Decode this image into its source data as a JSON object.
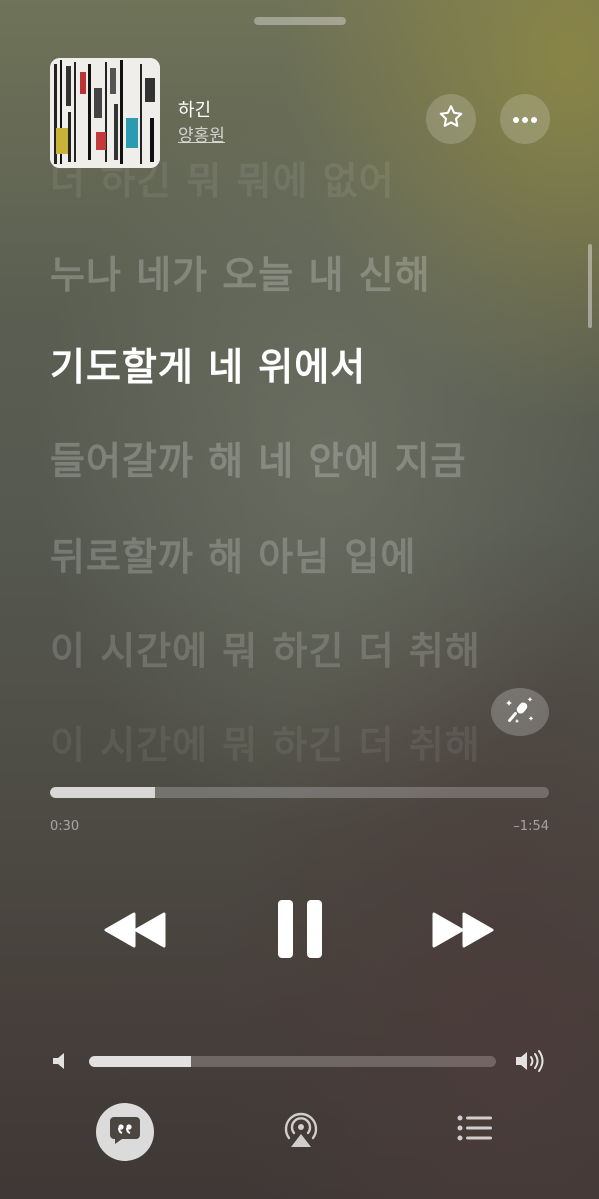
{
  "now_playing": {
    "title": "하긴",
    "artist": "양홍원"
  },
  "lyrics": [
    "더 하긴 뭐 뭐에 없어",
    "누나 네가 오늘 내 신해",
    "기도할게 네 위에서",
    "들어갈까 해 네 안에 지금",
    "뒤로할까 해 아님 입에",
    "이 시간에 뭐 하긴 더 취해",
    "이 시간에 뭐 하긴 더 취해"
  ],
  "playback": {
    "elapsed": "0:30",
    "remaining": "–1:54",
    "progress_fraction": 0.21
  },
  "volume": {
    "level_fraction": 0.25
  },
  "icons": {
    "favorite": "star-icon",
    "more": "ellipsis-icon",
    "lyrics_mic": "microphone-sparkle-icon",
    "rewind": "rewind-icon",
    "pause": "pause-icon",
    "forward": "fast-forward-icon",
    "volume_low": "speaker-icon",
    "volume_high": "speaker-wave-icon",
    "lyrics_tab": "quote-bubble-icon",
    "airplay": "airplay-icon",
    "queue": "list-icon"
  }
}
